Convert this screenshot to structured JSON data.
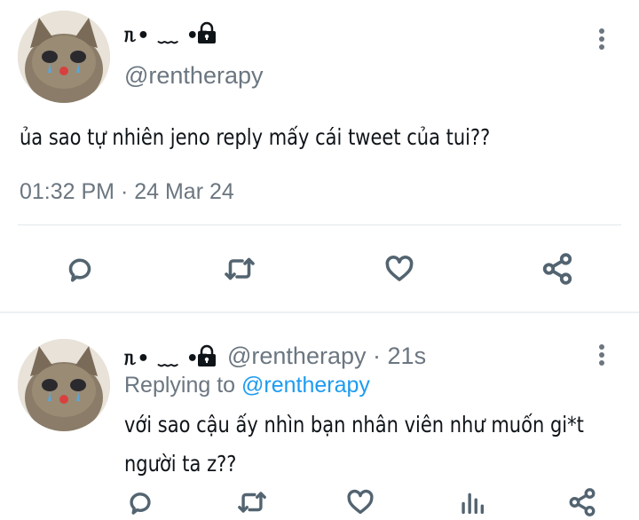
{
  "main_tweet": {
    "display_name": "ᥰ• ﹏ •ᥰ",
    "handle": "@rentherapy",
    "text": "ủa sao tự nhiên jeno reply mấy cái tweet của tui??",
    "timestamp": "01:32 PM · 24 Mar 24",
    "icons": [
      "lock-icon",
      "more-icon",
      "reply-icon",
      "retweet-icon",
      "like-icon",
      "share-icon"
    ]
  },
  "reply_tweet": {
    "display_name": "ᥰ• ﹏ •ᥰ",
    "handle": "@rentherapy",
    "separator": "·",
    "age": "21s",
    "replying_prefix": "Replying to",
    "replying_handle": "@rentherapy",
    "text_line1": "với sao cậu ấy nhìn bạn nhân viên như muốn gi*t",
    "text_line2": "người ta z??",
    "icons": [
      "lock-icon",
      "more-icon",
      "reply-icon",
      "retweet-icon",
      "like-icon",
      "analytics-icon",
      "share-icon"
    ]
  },
  "colors": {
    "secondary_text": "#6b7680",
    "link": "#1d9bf0",
    "icon": "#536471"
  }
}
